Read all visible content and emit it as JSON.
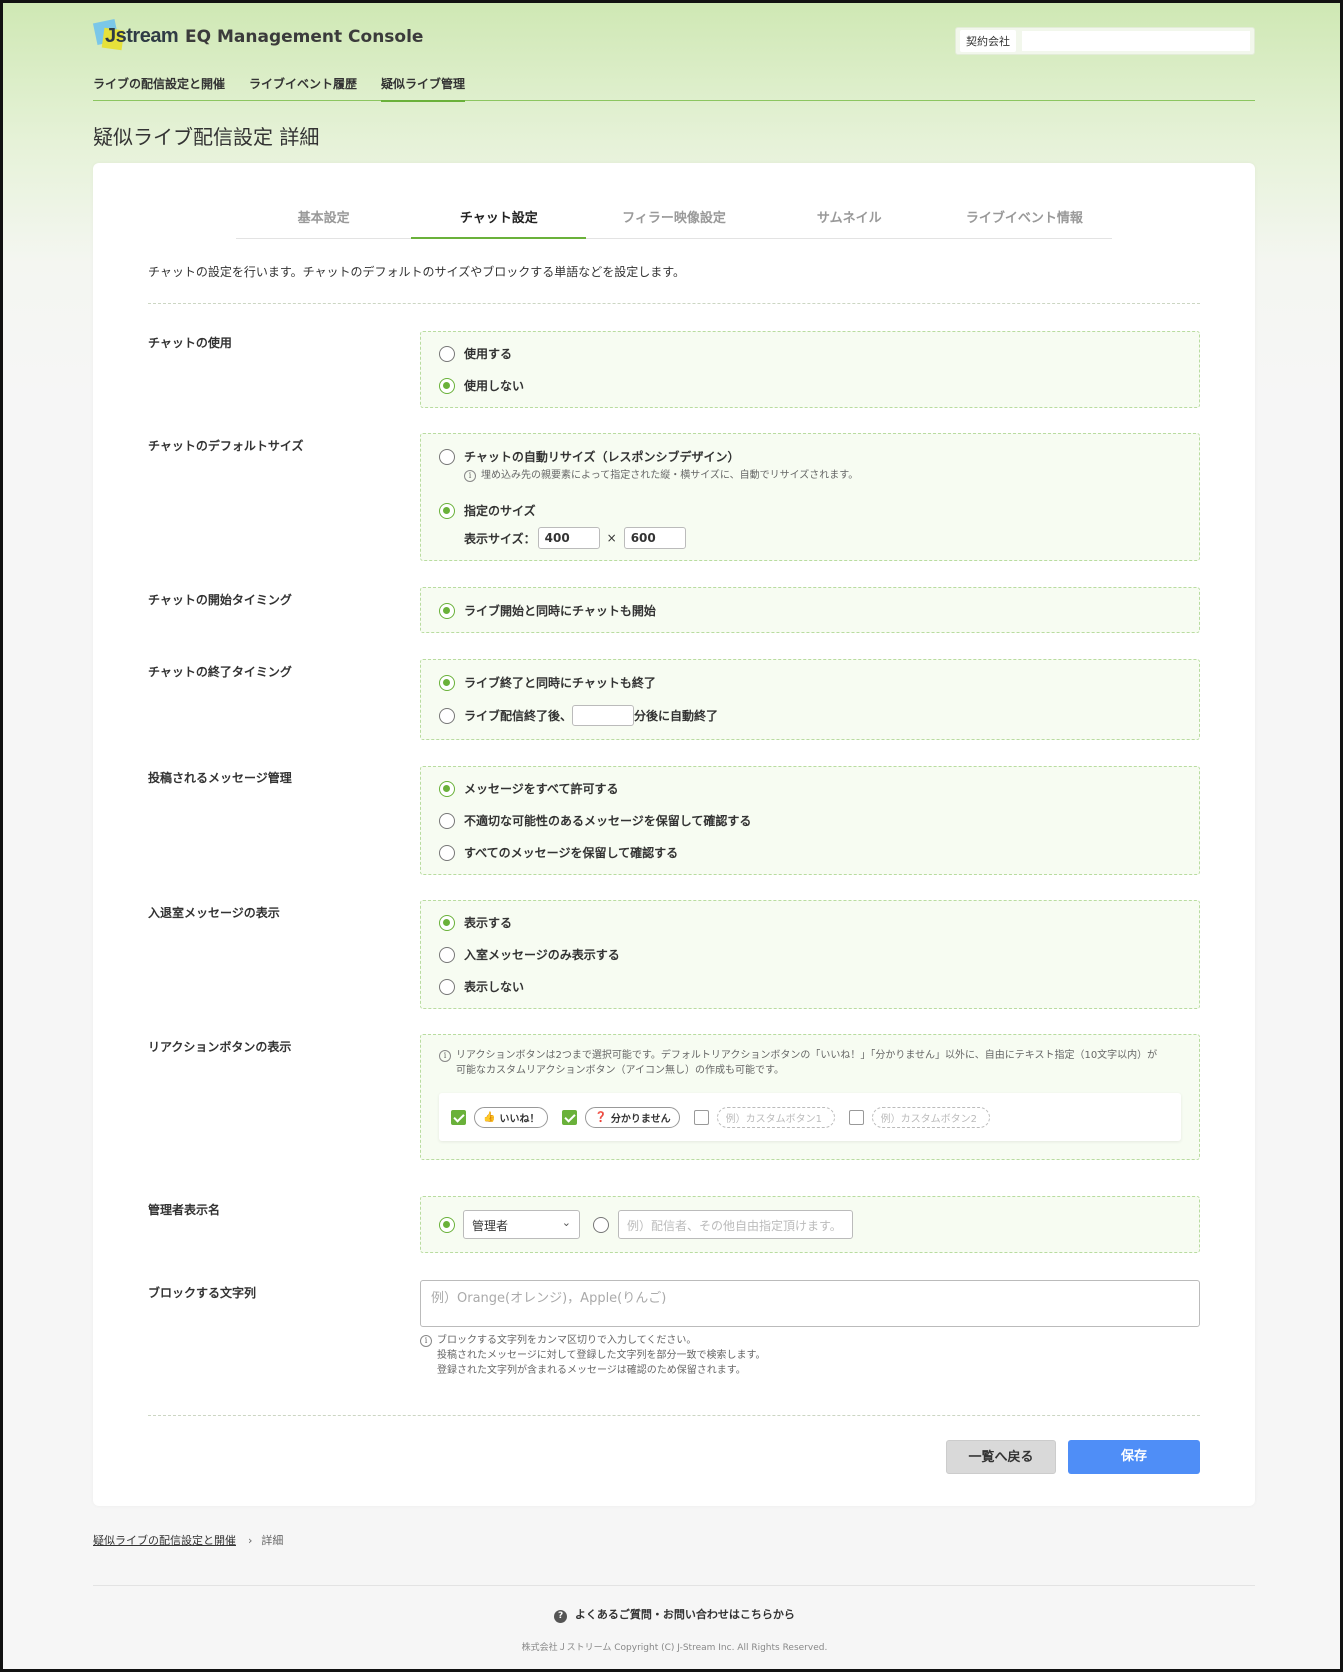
{
  "header": {
    "logo_text": "Jstream",
    "app_title": "EQ Management Console",
    "company_label": "契約会社",
    "company_value": ""
  },
  "nav": [
    {
      "label": "ライブの配信設定と開催"
    },
    {
      "label": "ライブイベント履歴"
    },
    {
      "label": "疑似ライブ管理",
      "active": true
    }
  ],
  "page_title": "疑似ライブ配信設定 詳細",
  "tabs": [
    {
      "label": "基本設定"
    },
    {
      "label": "チャット設定",
      "active": true
    },
    {
      "label": "フィラー映像設定"
    },
    {
      "label": "サムネイル"
    },
    {
      "label": "ライブイベント情報"
    }
  ],
  "description": "チャットの設定を行います。チャットのデフォルトのサイズやブロックする単語などを設定します。",
  "chat_use": {
    "label": "チャットの使用",
    "options": [
      "使用する",
      "使用しない"
    ],
    "selected": 1
  },
  "chat_size": {
    "label": "チャットのデフォルトサイズ",
    "auto_label": "チャットの自動リサイズ（レスポンシブデザイン）",
    "auto_note": "埋め込み先の親要素によって指定された縦・横サイズに、自動でリサイズされます。",
    "fixed_label": "指定のサイズ",
    "size_label": "表示サイズ：",
    "width": "400",
    "times": "×",
    "height": "600",
    "selected": 1
  },
  "chat_start": {
    "label": "チャットの開始タイミング",
    "options": [
      "ライブ開始と同時にチャットも開始"
    ]
  },
  "chat_end": {
    "label": "チャットの終了タイミング",
    "option1": "ライブ終了と同時にチャットも終了",
    "option2_prefix": "ライブ配信終了後、",
    "option2_value": "",
    "option2_suffix": "分後に自動終了"
  },
  "message_mgmt": {
    "label": "投稿されるメッセージ管理",
    "options": [
      "メッセージをすべて許可する",
      "不適切な可能性のあるメッセージを保留して確認する",
      "すべてのメッセージを保留して確認する"
    ],
    "selected": 0
  },
  "entry_msg": {
    "label": "入退室メッセージの表示",
    "options": [
      "表示する",
      "入室メッセージのみ表示する",
      "表示しない"
    ],
    "selected": 0
  },
  "reaction": {
    "label": "リアクションボタンの表示",
    "note_line1": "リアクションボタンは2つまで選択可能です。デフォルトリアクションボタンの「いいね！」「分かりません」以外に、自由にテキスト指定（10文字以内）が",
    "note_line2": "可能なカスタムリアクションボタン（アイコン無し）の作成も可能です。",
    "buttons": [
      {
        "label": "いいね！",
        "icon": "thumbs-up-icon",
        "checked": true
      },
      {
        "label": "分かりません",
        "icon": "question-icon",
        "checked": true
      },
      {
        "placeholder": "例）カスタムボタン1",
        "checked": false
      },
      {
        "placeholder": "例）カスタムボタン2",
        "checked": false
      }
    ]
  },
  "admin_name": {
    "label": "管理者表示名",
    "select_value": "管理者",
    "custom_placeholder": "例）配信者、その他自由指定頂けます。"
  },
  "block_words": {
    "label": "ブロックする文字列",
    "placeholder": "例）Orange(オレンジ)，Apple(りんご)",
    "note1": "ブロックする文字列をカンマ区切りで入力してください。",
    "note2": "投稿されたメッセージに対して登録した文字列を部分一致で検索します。",
    "note3": "登録された文字列が含まれるメッセージは確認のため保留されます。"
  },
  "buttons": {
    "back": "一覧へ戻る",
    "save": "保存"
  },
  "breadcrumb": {
    "parent": "疑似ライブの配信設定と開催",
    "separator": "›",
    "current": "詳細"
  },
  "footer": {
    "faq": "よくあるご質問・お問い合わせはこちらから",
    "copyright": "株式会社Ｊストリーム Copyright (C) J-Stream Inc. All Rights Reserved."
  },
  "colors": {
    "accent_green": "#6ab13a",
    "save_blue": "#4f8ef7"
  }
}
